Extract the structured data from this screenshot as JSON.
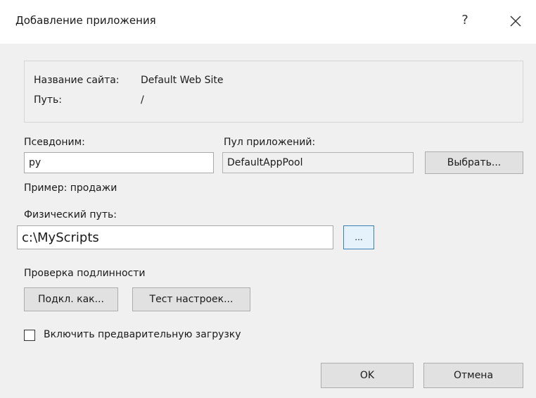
{
  "window": {
    "title": "Добавление приложения",
    "help_label": "?"
  },
  "site_info": {
    "site_name_label": "Название сайта:",
    "site_name_value": "Default Web Site",
    "path_label": "Путь:",
    "path_value": "/"
  },
  "alias": {
    "label": "Псевдоним:",
    "value": "py",
    "example": "Пример: продажи"
  },
  "app_pool": {
    "label": "Пул приложений:",
    "value": "DefaultAppPool",
    "select_button": "Выбрать..."
  },
  "physical_path": {
    "label": "Физический путь:",
    "value": "c:\\MyScripts",
    "browse_button": "..."
  },
  "auth": {
    "label": "Проверка подлинности",
    "connect_as_button": "Подкл. как...",
    "test_settings_button": "Тест настроек..."
  },
  "preload": {
    "label": "Включить предварительную загрузку",
    "checked": false
  },
  "footer": {
    "ok_button": "OK",
    "cancel_button": "Отмена"
  },
  "colors": {
    "dialog_bg": "#f0f0f0",
    "title_bg": "#ffffff",
    "accent_border": "#3c7fb1"
  }
}
